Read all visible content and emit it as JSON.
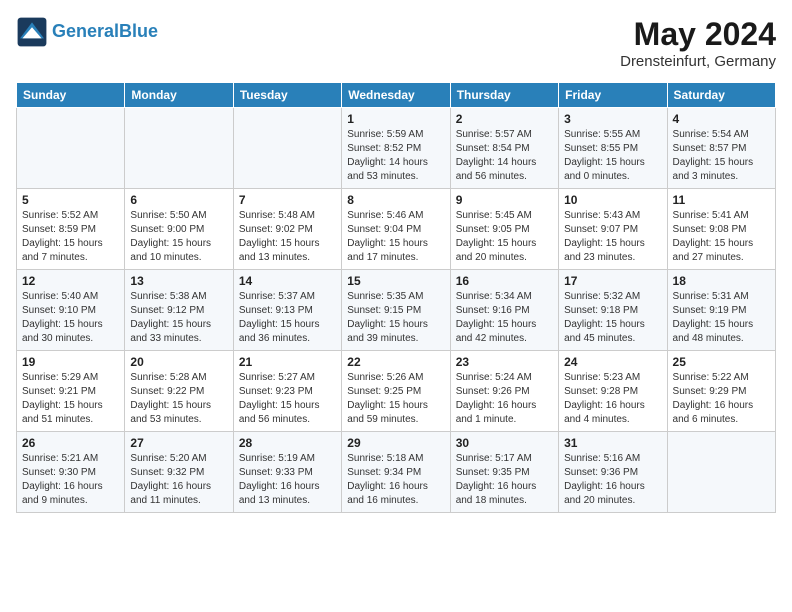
{
  "header": {
    "logo_line1": "General",
    "logo_line2": "Blue",
    "month": "May 2024",
    "location": "Drensteinfurt, Germany"
  },
  "weekdays": [
    "Sunday",
    "Monday",
    "Tuesday",
    "Wednesday",
    "Thursday",
    "Friday",
    "Saturday"
  ],
  "weeks": [
    [
      {
        "day": "",
        "info": ""
      },
      {
        "day": "",
        "info": ""
      },
      {
        "day": "",
        "info": ""
      },
      {
        "day": "1",
        "info": "Sunrise: 5:59 AM\nSunset: 8:52 PM\nDaylight: 14 hours and 53 minutes."
      },
      {
        "day": "2",
        "info": "Sunrise: 5:57 AM\nSunset: 8:54 PM\nDaylight: 14 hours and 56 minutes."
      },
      {
        "day": "3",
        "info": "Sunrise: 5:55 AM\nSunset: 8:55 PM\nDaylight: 15 hours and 0 minutes."
      },
      {
        "day": "4",
        "info": "Sunrise: 5:54 AM\nSunset: 8:57 PM\nDaylight: 15 hours and 3 minutes."
      }
    ],
    [
      {
        "day": "5",
        "info": "Sunrise: 5:52 AM\nSunset: 8:59 PM\nDaylight: 15 hours and 7 minutes."
      },
      {
        "day": "6",
        "info": "Sunrise: 5:50 AM\nSunset: 9:00 PM\nDaylight: 15 hours and 10 minutes."
      },
      {
        "day": "7",
        "info": "Sunrise: 5:48 AM\nSunset: 9:02 PM\nDaylight: 15 hours and 13 minutes."
      },
      {
        "day": "8",
        "info": "Sunrise: 5:46 AM\nSunset: 9:04 PM\nDaylight: 15 hours and 17 minutes."
      },
      {
        "day": "9",
        "info": "Sunrise: 5:45 AM\nSunset: 9:05 PM\nDaylight: 15 hours and 20 minutes."
      },
      {
        "day": "10",
        "info": "Sunrise: 5:43 AM\nSunset: 9:07 PM\nDaylight: 15 hours and 23 minutes."
      },
      {
        "day": "11",
        "info": "Sunrise: 5:41 AM\nSunset: 9:08 PM\nDaylight: 15 hours and 27 minutes."
      }
    ],
    [
      {
        "day": "12",
        "info": "Sunrise: 5:40 AM\nSunset: 9:10 PM\nDaylight: 15 hours and 30 minutes."
      },
      {
        "day": "13",
        "info": "Sunrise: 5:38 AM\nSunset: 9:12 PM\nDaylight: 15 hours and 33 minutes."
      },
      {
        "day": "14",
        "info": "Sunrise: 5:37 AM\nSunset: 9:13 PM\nDaylight: 15 hours and 36 minutes."
      },
      {
        "day": "15",
        "info": "Sunrise: 5:35 AM\nSunset: 9:15 PM\nDaylight: 15 hours and 39 minutes."
      },
      {
        "day": "16",
        "info": "Sunrise: 5:34 AM\nSunset: 9:16 PM\nDaylight: 15 hours and 42 minutes."
      },
      {
        "day": "17",
        "info": "Sunrise: 5:32 AM\nSunset: 9:18 PM\nDaylight: 15 hours and 45 minutes."
      },
      {
        "day": "18",
        "info": "Sunrise: 5:31 AM\nSunset: 9:19 PM\nDaylight: 15 hours and 48 minutes."
      }
    ],
    [
      {
        "day": "19",
        "info": "Sunrise: 5:29 AM\nSunset: 9:21 PM\nDaylight: 15 hours and 51 minutes."
      },
      {
        "day": "20",
        "info": "Sunrise: 5:28 AM\nSunset: 9:22 PM\nDaylight: 15 hours and 53 minutes."
      },
      {
        "day": "21",
        "info": "Sunrise: 5:27 AM\nSunset: 9:23 PM\nDaylight: 15 hours and 56 minutes."
      },
      {
        "day": "22",
        "info": "Sunrise: 5:26 AM\nSunset: 9:25 PM\nDaylight: 15 hours and 59 minutes."
      },
      {
        "day": "23",
        "info": "Sunrise: 5:24 AM\nSunset: 9:26 PM\nDaylight: 16 hours and 1 minute."
      },
      {
        "day": "24",
        "info": "Sunrise: 5:23 AM\nSunset: 9:28 PM\nDaylight: 16 hours and 4 minutes."
      },
      {
        "day": "25",
        "info": "Sunrise: 5:22 AM\nSunset: 9:29 PM\nDaylight: 16 hours and 6 minutes."
      }
    ],
    [
      {
        "day": "26",
        "info": "Sunrise: 5:21 AM\nSunset: 9:30 PM\nDaylight: 16 hours and 9 minutes."
      },
      {
        "day": "27",
        "info": "Sunrise: 5:20 AM\nSunset: 9:32 PM\nDaylight: 16 hours and 11 minutes."
      },
      {
        "day": "28",
        "info": "Sunrise: 5:19 AM\nSunset: 9:33 PM\nDaylight: 16 hours and 13 minutes."
      },
      {
        "day": "29",
        "info": "Sunrise: 5:18 AM\nSunset: 9:34 PM\nDaylight: 16 hours and 16 minutes."
      },
      {
        "day": "30",
        "info": "Sunrise: 5:17 AM\nSunset: 9:35 PM\nDaylight: 16 hours and 18 minutes."
      },
      {
        "day": "31",
        "info": "Sunrise: 5:16 AM\nSunset: 9:36 PM\nDaylight: 16 hours and 20 minutes."
      },
      {
        "day": "",
        "info": ""
      }
    ]
  ]
}
